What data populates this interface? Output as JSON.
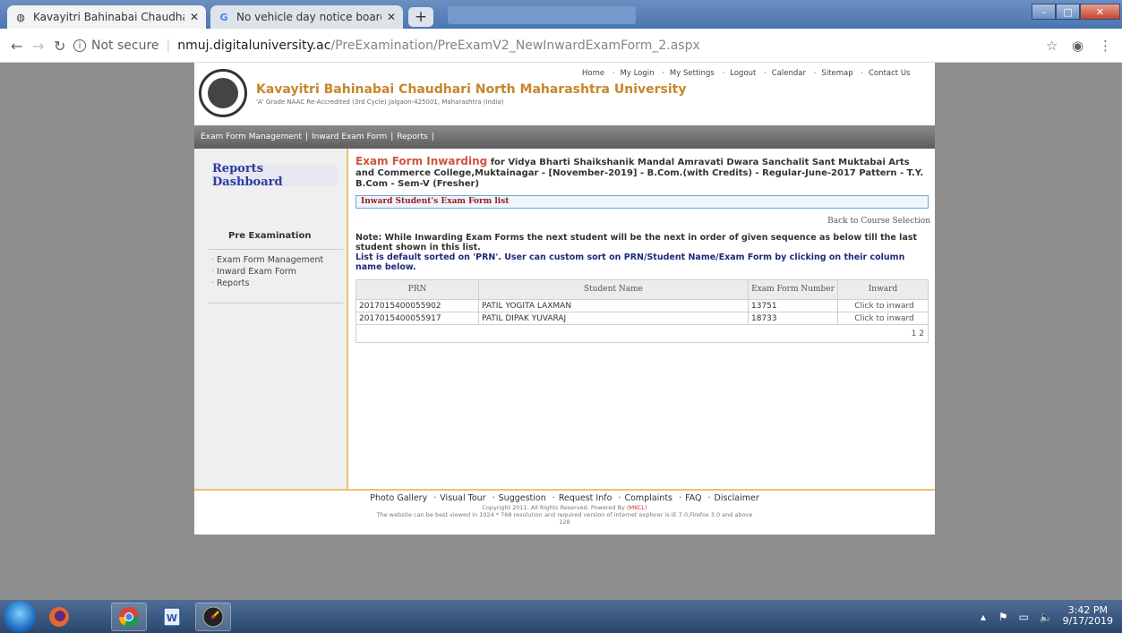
{
  "browser": {
    "tabs": [
      {
        "label": "Kavayitri Bahinabai Chaudhari N",
        "active": true
      },
      {
        "label": "No vehicle day notice board - G",
        "active": false
      }
    ],
    "address_not_secure": "Not secure",
    "address_separator": "|",
    "address_host": "nmuj.digitaluniversity.ac",
    "address_path": "/PreExamination/PreExamV2_NewInwardExamForm_2.aspx"
  },
  "header": {
    "university_name": "Kavayitri Bahinabai Chaudhari North Maharashtra University",
    "university_sub": "'A' Grade NAAC Re-Accredited (3rd Cycle) Jalgaon-425001, Maharashtra (India)",
    "top_links": [
      "Home",
      "My Login",
      "My Settings",
      "Logout",
      "Calendar",
      "Sitemap",
      "Contact Us"
    ]
  },
  "menubar": {
    "items": [
      "Exam Form Management",
      "Inward Exam Form",
      "Reports"
    ]
  },
  "sidebar": {
    "dashboard": "Reports Dashboard",
    "section": "Pre Examination",
    "links": [
      "Exam Form Management",
      "Inward Exam Form",
      "Reports"
    ]
  },
  "content": {
    "title_highlight": "Exam Form Inwarding",
    "title_rest": " for Vidya Bharti Shaikshanik Mandal Amravati Dwara Sanchalit Sant Muktabai Arts and Commerce College,Muktainagar - [November-2019] - B.Com.(with Credits) - Regular-June-2017 Pattern - T.Y. B.Com - Sem-V (Fresher)",
    "box_label": "Inward Student's Exam Form list",
    "back_link": "Back to Course Selection",
    "note": "Note: While Inwarding Exam Forms the next student will be the next in order of given sequence as below till the last student shown in this list.",
    "note2": "List is default sorted on 'PRN'. User can custom sort on PRN/Student Name/Exam Form by clicking on their column name below.",
    "table": {
      "headers": [
        "PRN",
        "Student Name",
        "Exam Form Number",
        "Inward"
      ],
      "rows": [
        {
          "prn": "2017015400055902",
          "name": "PATIL YOGITA LAXMAN",
          "form": "13751",
          "action": "Click to inward"
        },
        {
          "prn": "2017015400055917",
          "name": "PATIL DIPAK YUVARAJ",
          "form": "18733",
          "action": "Click to inward"
        }
      ],
      "pager": [
        "1",
        "2"
      ]
    }
  },
  "footer": {
    "links": [
      "Photo Gallery",
      "Visual Tour",
      "Suggestion",
      "Request Info",
      "Complaints",
      "FAQ",
      "Disclaimer"
    ],
    "copyright": "Copyright 2011. All Rights Reserved. Powered By ",
    "mkcl": "(MKCL)",
    "best_view": "The website can be best viewed in 1024 * 768 resolution and required version of internet explorer is IE 7.0,Firefox 3.0 and above",
    "counter": "128"
  },
  "taskbar": {
    "time": "3:42 PM",
    "date": "9/17/2019"
  }
}
